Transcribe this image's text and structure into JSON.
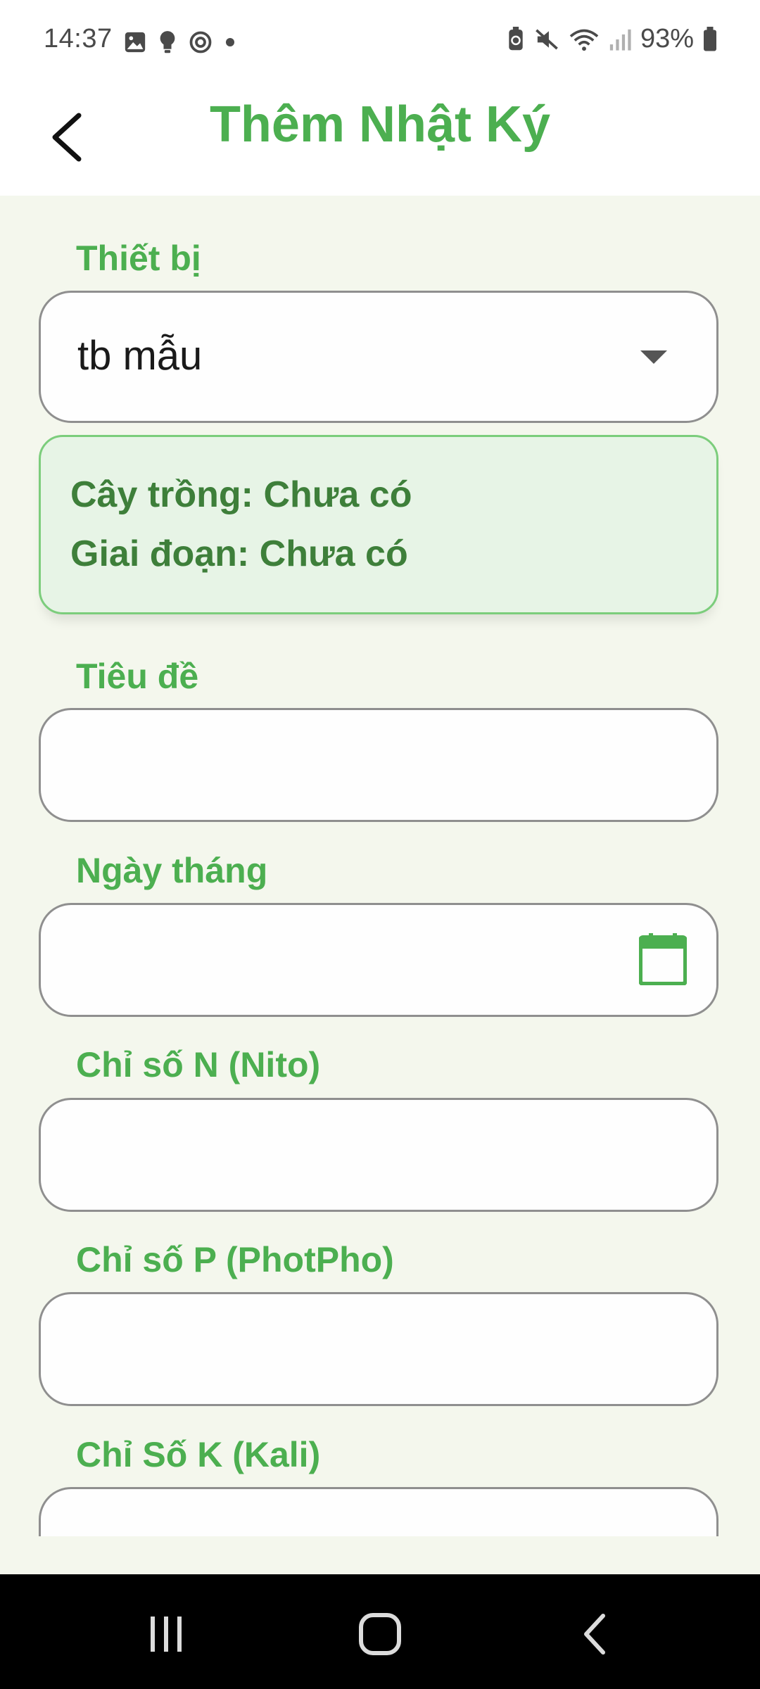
{
  "status_bar": {
    "time": "14:37",
    "battery": "93%",
    "left_icons": [
      "image-icon",
      "bulb-icon",
      "sync-icon",
      "dot-icon"
    ],
    "right_icons": [
      "battery-saver-icon",
      "mute-icon",
      "wifi-icon",
      "signal-icon",
      "battery-icon"
    ]
  },
  "app_bar": {
    "title": "Thêm Nhật Ký",
    "back_icon": "back-arrow-icon"
  },
  "form": {
    "device": {
      "label": "Thiết bị",
      "value": "tb mẫu"
    },
    "info": {
      "crop": "Cây trồng: Chưa có",
      "stage": "Giai đoạn: Chưa có"
    },
    "title_field": {
      "label": "Tiêu đề",
      "value": ""
    },
    "date_field": {
      "label": "Ngày tháng",
      "value": ""
    },
    "n_field": {
      "label": "Chỉ số N (Nito)",
      "value": ""
    },
    "p_field": {
      "label": "Chỉ số P (PhotPho)",
      "value": ""
    },
    "k_field": {
      "label": "Chỉ Số K (Kali)",
      "value": ""
    }
  },
  "colors": {
    "accent": "#4caf50",
    "info_bg": "#e7f4e6",
    "info_text": "#3e7f3a",
    "page_bg": "#f4f7ed"
  }
}
